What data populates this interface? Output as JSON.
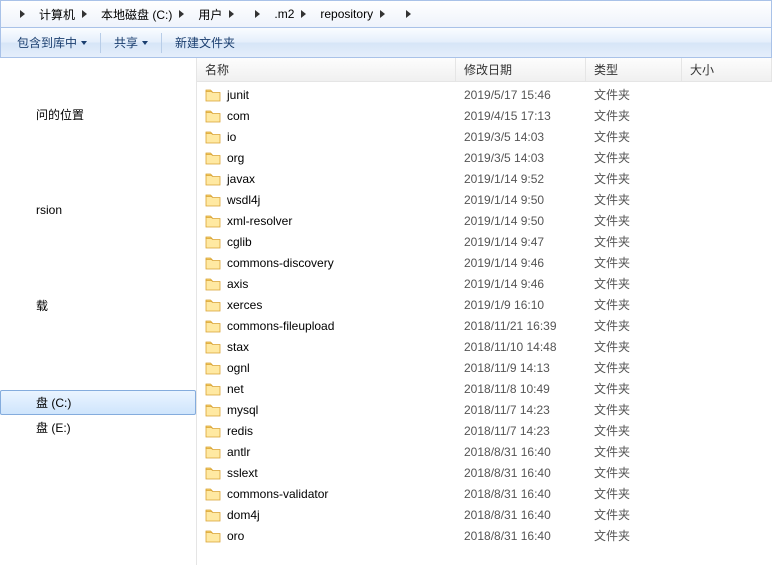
{
  "breadcrumb": {
    "items": [
      "计算机",
      "本地磁盘 (C:)",
      "用户",
      "",
      ".m2",
      "repository",
      ""
    ]
  },
  "toolbar": {
    "include": "包含到库中",
    "share": "共享",
    "newfolder": "新建文件夹"
  },
  "nav": {
    "recent": "问的位置",
    "spacer1": "",
    "svn": "rsion",
    "spacer2": "",
    "downloads": "载",
    "spacer3": "",
    "disk_c": "盘 (C:)",
    "disk_e": "盘 (E:)"
  },
  "columns": {
    "name": "名称",
    "date": "修改日期",
    "type": "类型",
    "size": "大小"
  },
  "rows": [
    {
      "name": "junit",
      "date": "2019/5/17 15:46",
      "type": "文件夹"
    },
    {
      "name": "com",
      "date": "2019/4/15 17:13",
      "type": "文件夹"
    },
    {
      "name": "io",
      "date": "2019/3/5 14:03",
      "type": "文件夹"
    },
    {
      "name": "org",
      "date": "2019/3/5 14:03",
      "type": "文件夹"
    },
    {
      "name": "javax",
      "date": "2019/1/14 9:52",
      "type": "文件夹"
    },
    {
      "name": "wsdl4j",
      "date": "2019/1/14 9:50",
      "type": "文件夹"
    },
    {
      "name": "xml-resolver",
      "date": "2019/1/14 9:50",
      "type": "文件夹"
    },
    {
      "name": "cglib",
      "date": "2019/1/14 9:47",
      "type": "文件夹"
    },
    {
      "name": "commons-discovery",
      "date": "2019/1/14 9:46",
      "type": "文件夹"
    },
    {
      "name": "axis",
      "date": "2019/1/14 9:46",
      "type": "文件夹"
    },
    {
      "name": "xerces",
      "date": "2019/1/9 16:10",
      "type": "文件夹"
    },
    {
      "name": "commons-fileupload",
      "date": "2018/11/21 16:39",
      "type": "文件夹"
    },
    {
      "name": "stax",
      "date": "2018/11/10 14:48",
      "type": "文件夹"
    },
    {
      "name": "ognl",
      "date": "2018/11/9 14:13",
      "type": "文件夹"
    },
    {
      "name": "net",
      "date": "2018/11/8 10:49",
      "type": "文件夹"
    },
    {
      "name": "mysql",
      "date": "2018/11/7 14:23",
      "type": "文件夹"
    },
    {
      "name": "redis",
      "date": "2018/11/7 14:23",
      "type": "文件夹"
    },
    {
      "name": "antlr",
      "date": "2018/8/31 16:40",
      "type": "文件夹"
    },
    {
      "name": "sslext",
      "date": "2018/8/31 16:40",
      "type": "文件夹"
    },
    {
      "name": "commons-validator",
      "date": "2018/8/31 16:40",
      "type": "文件夹"
    },
    {
      "name": "dom4j",
      "date": "2018/8/31 16:40",
      "type": "文件夹"
    },
    {
      "name": "oro",
      "date": "2018/8/31 16:40",
      "type": "文件夹"
    }
  ]
}
